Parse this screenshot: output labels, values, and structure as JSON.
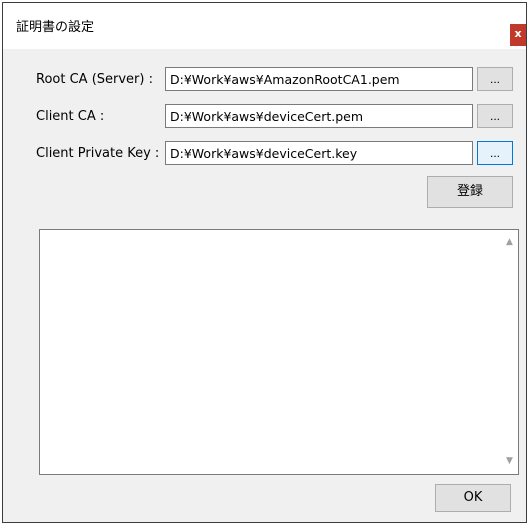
{
  "window": {
    "title": "証明書の設定",
    "close_label": "x"
  },
  "form": {
    "root_ca": {
      "label": "Root CA (Server) :",
      "value": "D:¥Work¥aws¥AmazonRootCA1.pem",
      "browse_label": "..."
    },
    "client_ca": {
      "label": "Client CA :",
      "value": "D:¥Work¥aws¥deviceCert.pem",
      "browse_label": "..."
    },
    "client_key": {
      "label": "Client Private Key :",
      "value": "D:¥Work¥aws¥deviceCert.key",
      "browse_label": "..."
    },
    "register_label": "登録"
  },
  "log": {
    "scroll_up_icon": "▲",
    "scroll_down_icon": "▼"
  },
  "footer": {
    "ok_label": "OK"
  }
}
